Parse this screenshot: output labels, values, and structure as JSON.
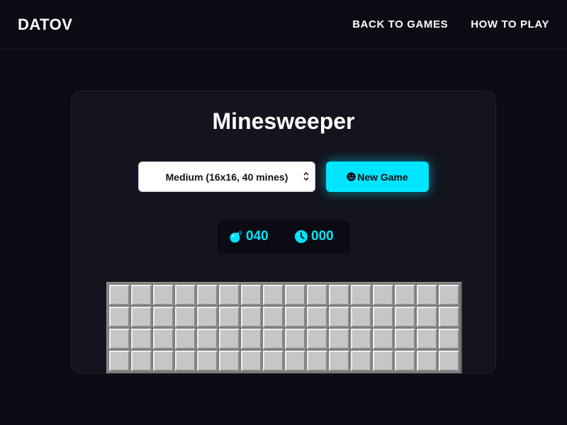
{
  "header": {
    "logo": "DATOV",
    "nav": [
      {
        "label": "BACK TO GAMES"
      },
      {
        "label": "HOW TO PLAY"
      }
    ]
  },
  "game": {
    "title": "Minesweeper",
    "difficulty": {
      "selected": "Medium (16x16, 40 mines)"
    },
    "new_game_label": "New Game",
    "mines_remaining": "040",
    "timer": "000",
    "board": {
      "columns": 16,
      "visible_rows": 4,
      "cell_state": "unrevealed"
    }
  },
  "colors": {
    "background": "#0b0c14",
    "card": "#13141e",
    "accent": "#00e5ff",
    "cell": "#c6c6c6"
  },
  "icons": {
    "mines": "bomb-icon",
    "timer": "clock-icon",
    "new_game": "smiley-icon",
    "select": "caret-icon"
  }
}
